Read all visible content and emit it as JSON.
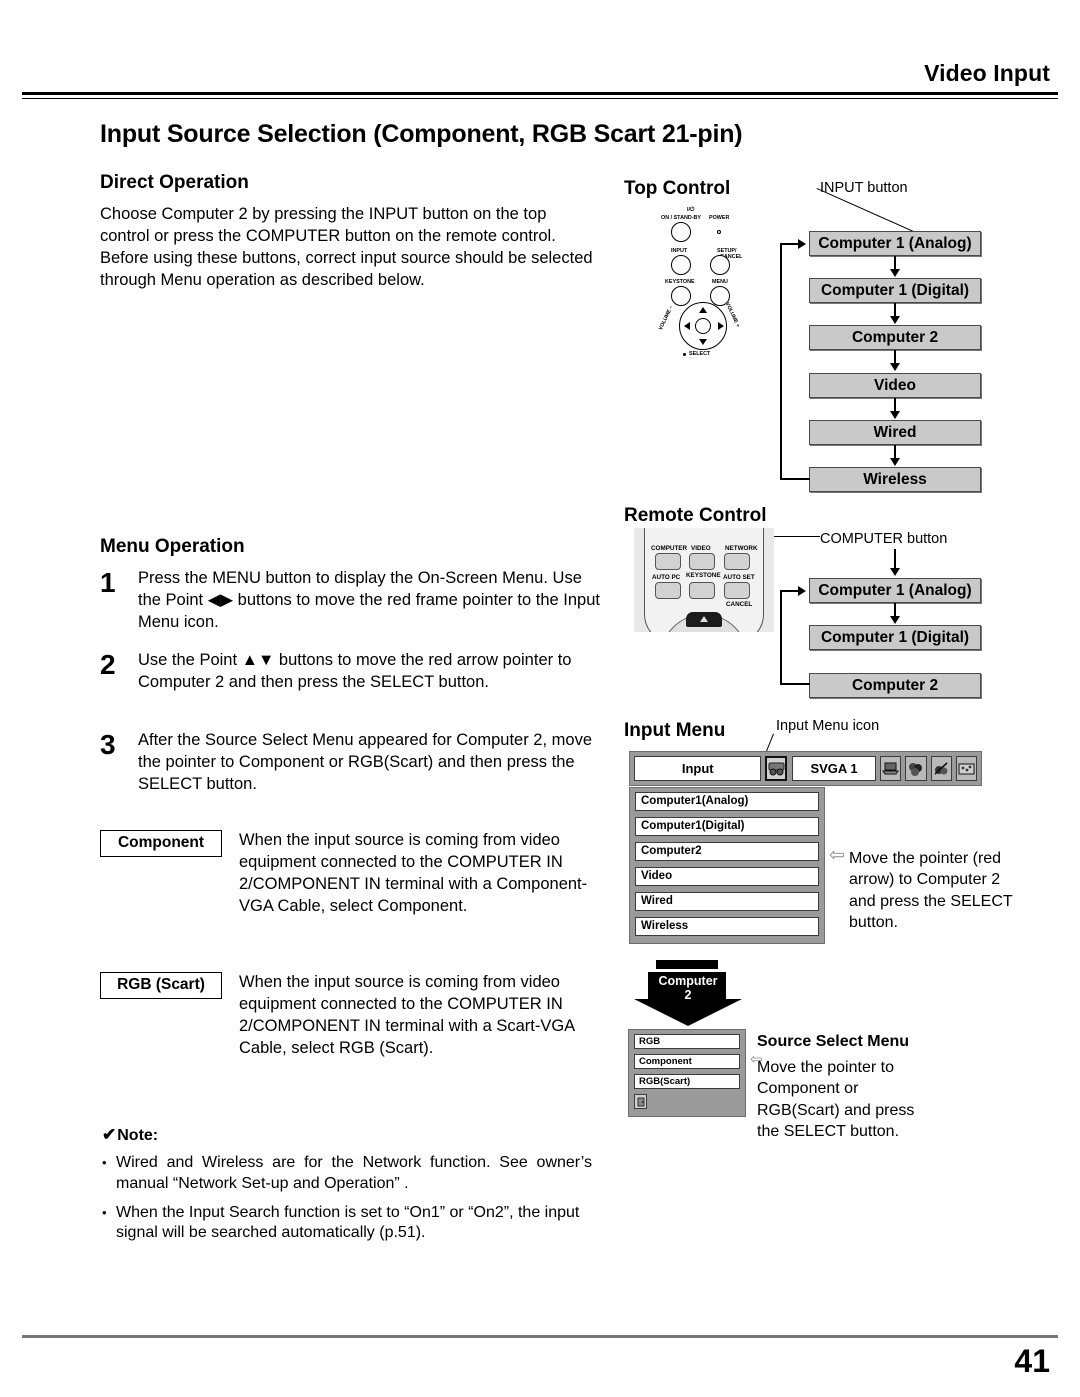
{
  "header": {
    "section_title": "Video Input"
  },
  "page_title": "Input Source Selection (Component, RGB Scart 21-pin)",
  "direct_operation": {
    "heading": "Direct Operation",
    "body": "Choose Computer 2 by pressing the INPUT button on the top control or press the COMPUTER button on the remote control.\nBefore using these buttons, correct input source should be selected through Menu operation as described below."
  },
  "menu_operation": {
    "heading": "Menu Operation",
    "steps": [
      {
        "num": "1",
        "text": "Press the MENU button to display the On-Screen Menu. Use the Point ◀▶ buttons to move the red frame pointer to the Input Menu icon."
      },
      {
        "num": "2",
        "text": "Use the Point ▲▼ buttons to move the red arrow pointer to Computer 2 and then press the SELECT button."
      },
      {
        "num": "3",
        "text": "After the Source Select Menu appeared for Computer 2, move the pointer to Component or RGB(Scart) and then press the SELECT button."
      }
    ]
  },
  "definitions": [
    {
      "tag": "Component",
      "text": "When the input source is coming from video equipment connected to the COMPUTER IN 2/COMPONENT IN terminal with a Component-VGA Cable, select Component."
    },
    {
      "tag": "RGB (Scart)",
      "text": "When the input source is coming from video equipment connected to the COMPUTER IN 2/COMPONENT IN terminal with a Scart-VGA Cable, select RGB (Scart)."
    }
  ],
  "note": {
    "check": "✔",
    "heading": "Note:",
    "bullet": "•",
    "items": [
      "Wired and Wireless are for the Network function. See owner’s manual “Network Set-up and Operation” .",
      "When the Input Search function is set to “On1” or “On2”, the input signal will be searched automatically (p.51)."
    ]
  },
  "top_control": {
    "heading": "Top Control",
    "callout": "INPUT button",
    "panel_labels": {
      "onstandby_sym": "I/⏻",
      "onstandby": "ON / STAND-BY",
      "power": "POWER",
      "input": "INPUT",
      "setup": "SETUP/",
      "cancel": "CANCEL",
      "keystone": "KEYSTONE",
      "menu": "MENU",
      "select": "SELECT",
      "volume_minus": "VOLUME –",
      "volume_plus": "VOLUME +"
    },
    "cycle": [
      "Computer 1 (Analog)",
      "Computer 1 (Digital)",
      "Computer 2",
      "Video",
      "Wired",
      "Wireless"
    ]
  },
  "remote_control": {
    "heading": "Remote Control",
    "callout": "COMPUTER button",
    "buttons": [
      "COMPUTER",
      "VIDEO",
      "NETWORK",
      "AUTO PC",
      "KEYSTONE",
      "AUTO SET",
      "CANCEL"
    ],
    "cycle": [
      "Computer 1 (Analog)",
      "Computer 1 (Digital)",
      "Computer 2"
    ]
  },
  "input_menu": {
    "heading": "Input Menu",
    "callout": "Input Menu icon",
    "bar": {
      "title": "Input",
      "icon": "input-menu-icon",
      "signal": "SVGA 1",
      "icons": [
        "computer-icon",
        "image-adjust-icon",
        "screen-icon",
        "settings-icon"
      ]
    },
    "items": [
      "Computer1(Analog)",
      "Computer1(Digital)",
      "Computer2",
      "Video",
      "Wired",
      "Wireless"
    ],
    "pointer_at": "Computer2",
    "pointer_glyph": "⇦",
    "side_text": "Move the pointer (red arrow) to Computer 2 and press the SELECT button."
  },
  "source_select": {
    "arrow_label_line1": "Computer",
    "arrow_label_line2": "2",
    "items": [
      "RGB",
      "Component",
      "RGB(Scart)"
    ],
    "exit_icon": "exit-icon",
    "pointer_glyph": "⇦",
    "heading": "Source Select Menu",
    "side_text": "Move the pointer to Component or RGB(Scart) and press the SELECT button."
  },
  "footer": {
    "page_number": "41"
  }
}
